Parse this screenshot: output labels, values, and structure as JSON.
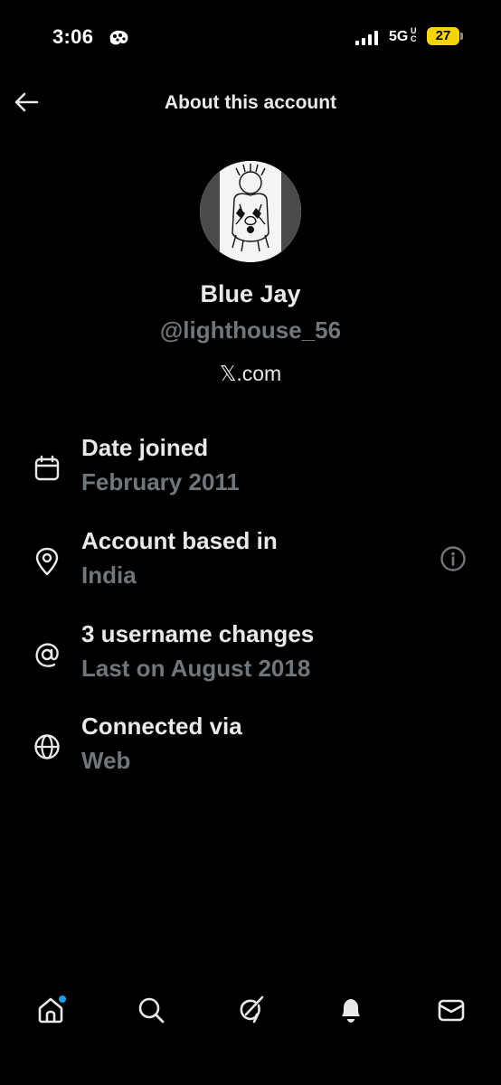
{
  "status_bar": {
    "time": "3:06",
    "network": "5G",
    "network_sub": "UC",
    "battery": "27",
    "battery_color": "#f5d40b"
  },
  "header": {
    "back_icon": "arrow-left-icon",
    "title": "About this account"
  },
  "profile": {
    "display_name": "Blue Jay",
    "username": "@lighthouse_56",
    "site": "𝕏.com"
  },
  "info_rows": [
    {
      "icon": "calendar-icon",
      "title": "Date joined",
      "value": "February 2011"
    },
    {
      "icon": "location-pin-icon",
      "title": "Account based in",
      "value": "India",
      "extra_icon": "info-icon"
    },
    {
      "icon": "at-sign-icon",
      "title": "3 username changes",
      "value": "Last on August 2018"
    },
    {
      "icon": "globe-icon",
      "title": "Connected via",
      "value": "Web"
    }
  ],
  "bottom_nav": [
    {
      "icon": "home-icon",
      "notification_dot": true
    },
    {
      "icon": "search-icon"
    },
    {
      "icon": "grok-icon"
    },
    {
      "icon": "bell-icon"
    },
    {
      "icon": "mail-icon"
    }
  ],
  "colors": {
    "background": "#000000",
    "primary_text": "#e7e9ea",
    "secondary_text": "#71767b",
    "accent": "#1d9bf0"
  }
}
